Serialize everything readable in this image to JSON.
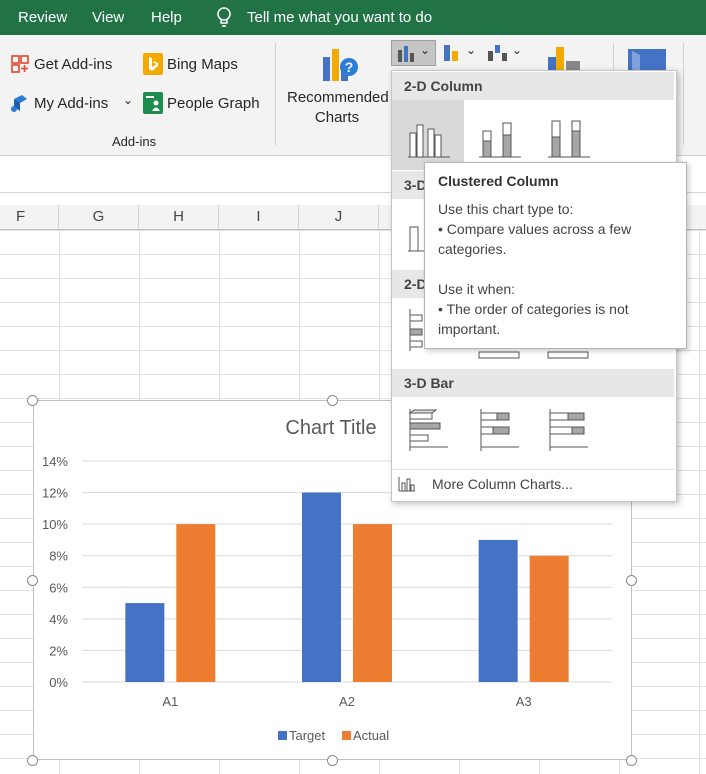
{
  "tabs": [
    "Review",
    "View",
    "Help"
  ],
  "tell_me": "Tell me what you want to do",
  "ribbon": {
    "get_addins": "Get Add-ins",
    "my_addins": "My Add-ins",
    "bing_maps": "Bing Maps",
    "people_graph": "People Graph",
    "group_label": "Add-ins",
    "recommended_charts": [
      "Recommended",
      "Charts"
    ]
  },
  "columns": [
    "F",
    "G",
    "H",
    "I",
    "J"
  ],
  "dropdown": {
    "section_2d_column": "2-D Column",
    "section_3d_column": "3-D",
    "section_2d_bar": "2-D",
    "section_3d_bar": "3-D Bar",
    "more": "More Column Charts..."
  },
  "tooltip": {
    "title": "Clustered Column",
    "line1": "Use this chart type to:",
    "line2": "• Compare values across a few",
    "line3": "categories.",
    "line4": "Use it when:",
    "line5": "• The order of categories is not",
    "line6": "important."
  },
  "colors": {
    "excel_green": "#217346",
    "target": "#4472C4",
    "actual": "#ED7D31"
  },
  "chart_data": {
    "type": "bar",
    "title": "Chart Title",
    "categories": [
      "A1",
      "A2",
      "A3"
    ],
    "series": [
      {
        "name": "Target",
        "values": [
          5,
          12,
          9
        ]
      },
      {
        "name": "Actual",
        "values": [
          10,
          10,
          8
        ]
      }
    ],
    "y_ticks": [
      "0%",
      "2%",
      "4%",
      "6%",
      "8%",
      "10%",
      "12%",
      "14%"
    ],
    "ylim": [
      0,
      14
    ],
    "legend": "bottom",
    "grid": true
  }
}
